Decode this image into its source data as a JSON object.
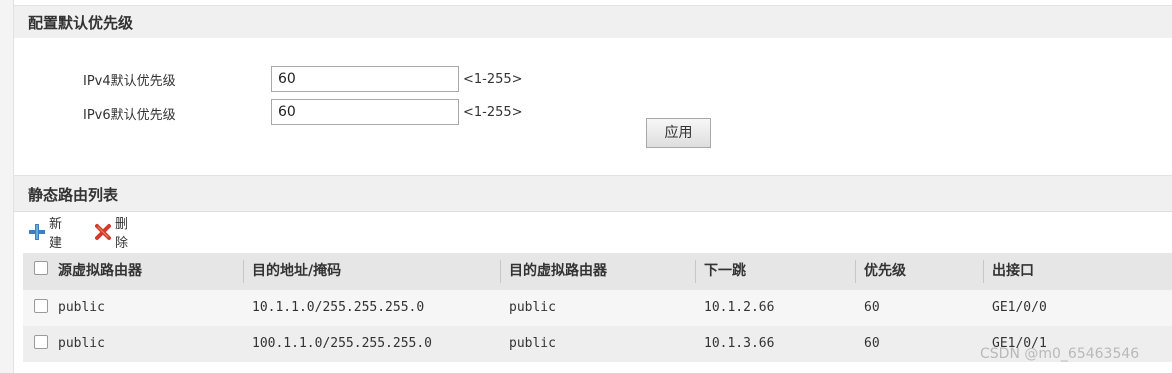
{
  "priority_section": {
    "title": "配置默认优先级",
    "ipv4_label": "IPv4默认优先级",
    "ipv4_value": "60",
    "ipv4_range": "<1-255>",
    "ipv6_label": "IPv6默认优先级",
    "ipv6_value": "60",
    "ipv6_range": "<1-255>",
    "apply_label": "应用"
  },
  "route_section": {
    "title": "静态路由列表",
    "toolbar": {
      "new_label": "新建",
      "new_icon": "plus-icon",
      "delete_label": "删除",
      "delete_icon": "delete-x-icon"
    },
    "columns": [
      "源虚拟路由器",
      "目的地址/掩码",
      "目的虚拟路由器",
      "下一跳",
      "优先级",
      "出接口"
    ],
    "rows": [
      [
        "public",
        "10.1.1.0/255.255.255.0",
        "public",
        "10.1.2.66",
        "60",
        "GE1/0/0"
      ],
      [
        "public",
        "100.1.1.0/255.255.255.0",
        "public",
        "10.1.3.66",
        "60",
        "GE1/0/1"
      ]
    ]
  },
  "watermark": "CSDN @m0_65463546",
  "colors": {
    "header_bg": "#f0f0f0",
    "table_head_bg": "#e6e6e6",
    "plus_icon": "#3a7fc4",
    "delete_icon": "#d23a2a"
  }
}
